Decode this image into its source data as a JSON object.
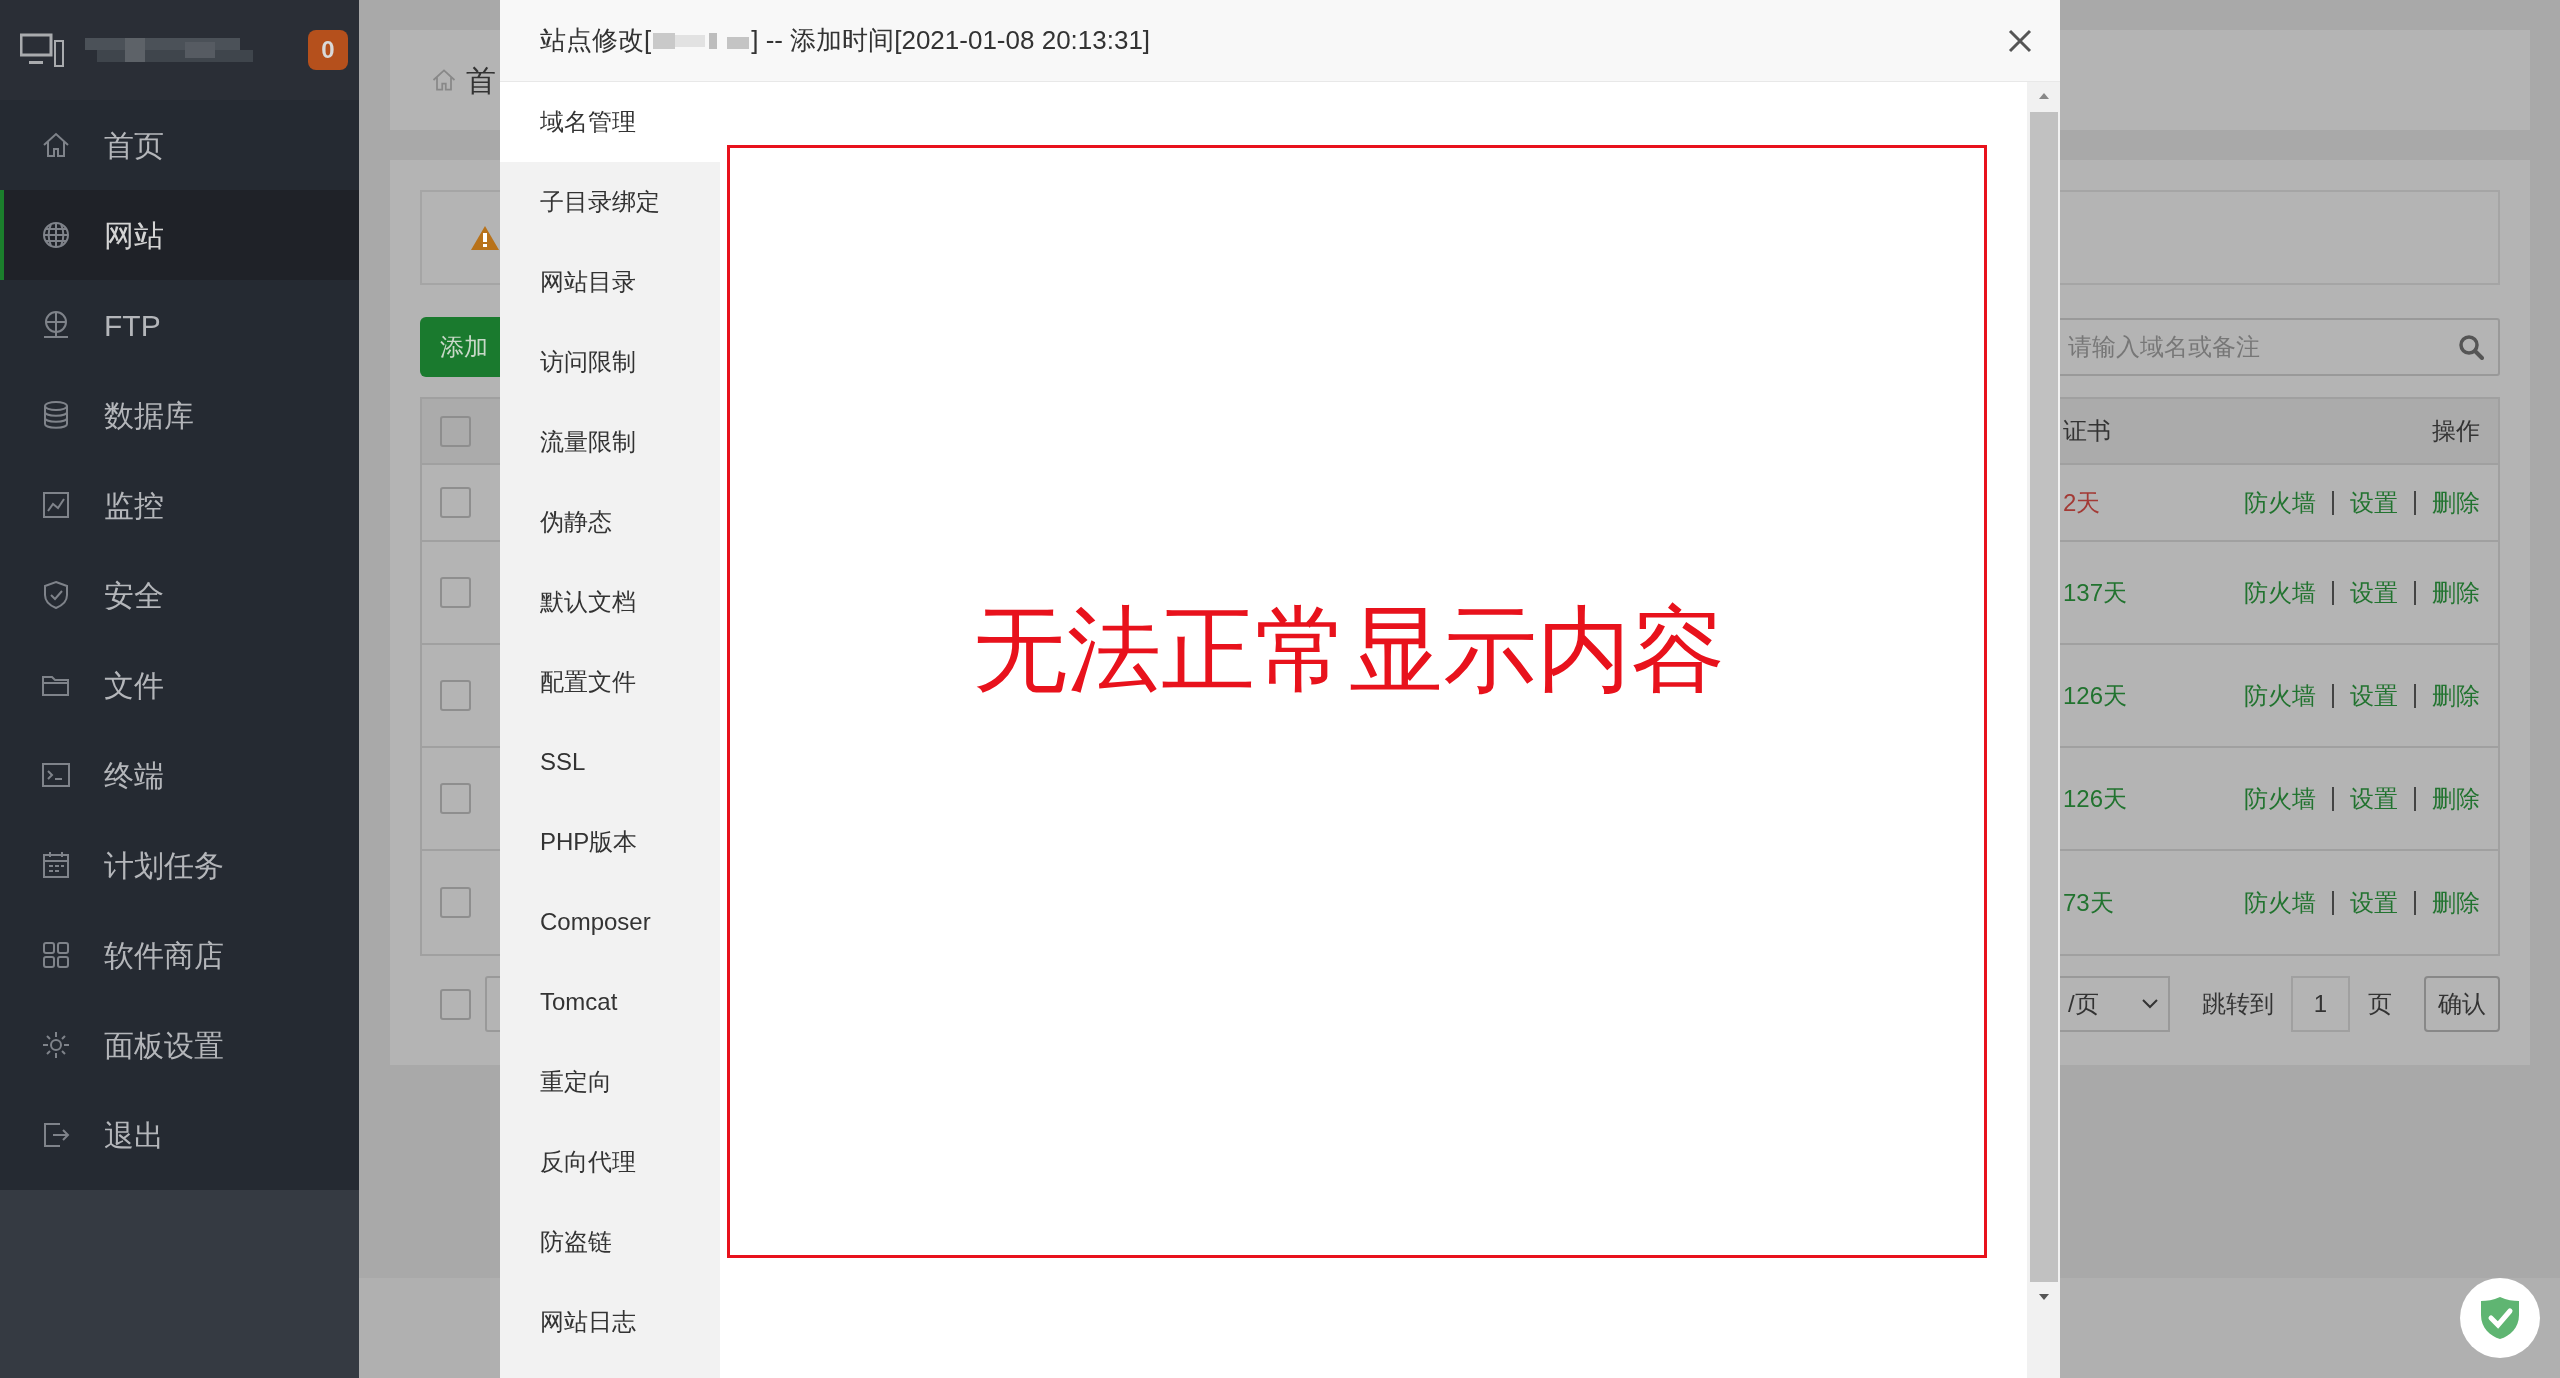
{
  "sidebar": {
    "badge": "0",
    "items": [
      {
        "label": "首页",
        "selected": false
      },
      {
        "label": "网站",
        "selected": true
      },
      {
        "label": "FTP",
        "selected": false
      },
      {
        "label": "数据库",
        "selected": false
      },
      {
        "label": "监控",
        "selected": false
      },
      {
        "label": "安全",
        "selected": false
      },
      {
        "label": "文件",
        "selected": false
      },
      {
        "label": "终端",
        "selected": false
      },
      {
        "label": "计划任务",
        "selected": false
      },
      {
        "label": "软件商店",
        "selected": false
      },
      {
        "label": "面板设置",
        "selected": false
      },
      {
        "label": "退出",
        "selected": false
      }
    ]
  },
  "page": {
    "breadcrumb": "首",
    "add_button": "添加",
    "search": {
      "placeholder": "请输入域名或备注"
    },
    "table": {
      "columns": [
        "证书",
        "操作"
      ],
      "header_checked": false,
      "rows": [
        {
          "checked": false,
          "cert": "2天",
          "expiring": true,
          "actions": [
            "防火墙",
            "设置",
            "删除"
          ]
        },
        {
          "checked": false,
          "cert": "137天",
          "expiring": false,
          "actions": [
            "防火墙",
            "设置",
            "删除"
          ]
        },
        {
          "checked": false,
          "cert": "126天",
          "expiring": false,
          "actions": [
            "防火墙",
            "设置",
            "删除"
          ]
        },
        {
          "checked": false,
          "cert": "126天",
          "expiring": false,
          "actions": [
            "防火墙",
            "设置",
            "删除"
          ]
        },
        {
          "checked": false,
          "cert": "73天",
          "expiring": false,
          "actions": [
            "防火墙",
            "设置",
            "删除"
          ]
        }
      ]
    },
    "pagination": {
      "select_all_checked": false,
      "page_size": "/页",
      "jump_label": "跳转到",
      "page": "1",
      "page_unit": "页",
      "confirm": "确认"
    }
  },
  "modal": {
    "title_prefix": "站点修改[",
    "title_suffix": "] -- 添加时间[2021-01-08 20:13:31]",
    "tabs": [
      {
        "label": "域名管理",
        "selected": true
      },
      {
        "label": "子目录绑定",
        "selected": false
      },
      {
        "label": "网站目录",
        "selected": false
      },
      {
        "label": "访问限制",
        "selected": false
      },
      {
        "label": "流量限制",
        "selected": false
      },
      {
        "label": "伪静态",
        "selected": false
      },
      {
        "label": "默认文档",
        "selected": false
      },
      {
        "label": "配置文件",
        "selected": false
      },
      {
        "label": "SSL",
        "selected": false
      },
      {
        "label": "PHP版本",
        "selected": false
      },
      {
        "label": "Composer",
        "selected": false
      },
      {
        "label": "Tomcat",
        "selected": false
      },
      {
        "label": "重定向",
        "selected": false
      },
      {
        "label": "反向代理",
        "selected": false
      },
      {
        "label": "防盗链",
        "selected": false
      },
      {
        "label": "网站日志",
        "selected": false
      }
    ],
    "message": "无法正常显示内容"
  }
}
